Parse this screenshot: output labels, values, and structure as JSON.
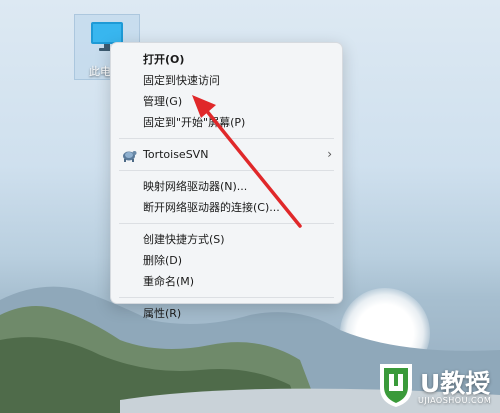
{
  "desktop": {
    "icon_label": "此电"
  },
  "context_menu": {
    "items": [
      {
        "label": "打开(O)"
      },
      {
        "label": "固定到快速访问"
      },
      {
        "label": "管理(G)"
      },
      {
        "label": "固定到\"开始\"屏幕(P)"
      },
      {
        "label": "TortoiseSVN"
      },
      {
        "label": "映射网络驱动器(N)..."
      },
      {
        "label": "断开网络驱动器的连接(C)..."
      },
      {
        "label": "创建快捷方式(S)"
      },
      {
        "label": "删除(D)"
      },
      {
        "label": "重命名(M)"
      },
      {
        "label": "属性(R)"
      }
    ],
    "submenu_chevron": "›"
  },
  "watermark": {
    "name": "U教授",
    "site": "UJIAOSHOU.COM"
  },
  "colors": {
    "arrow": "#e0282a",
    "brand_green": "#3a9a3a"
  }
}
